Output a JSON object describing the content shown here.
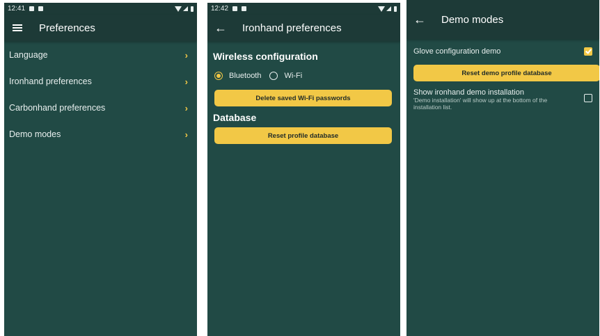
{
  "screen1": {
    "status_time": "12:41",
    "title": "Preferences",
    "items": [
      {
        "label": "Language"
      },
      {
        "label": "Ironhand preferences"
      },
      {
        "label": "Carbonhand preferences"
      },
      {
        "label": "Demo modes"
      }
    ]
  },
  "screen2": {
    "status_time": "12:42",
    "title": "Ironhand preferences",
    "wireless_title": "Wireless configuration",
    "radio_bluetooth": "Bluetooth",
    "radio_wifi": "Wi-Fi",
    "delete_wifi_button": "Delete saved Wi-Fi passwords",
    "database_title": "Database",
    "reset_profile_button": "Reset profile database"
  },
  "screen3": {
    "title": "Demo modes",
    "glove_demo_label": "Glove configuration demo",
    "glove_demo_checked": true,
    "reset_demo_button": "Reset demo profile database",
    "show_demo_label": "Show ironhand demo installation",
    "show_demo_desc": "'Demo installation' will show up at the bottom of the installation list.",
    "show_demo_checked": false
  },
  "colors": {
    "background": "#214a45",
    "appbar": "#1d3a37",
    "accent": "#f2c846"
  },
  "icons": [
    "hamburger-menu-icon",
    "back-arrow-icon",
    "chevron-right-icon",
    "radio-icon",
    "checkbox-icon"
  ]
}
